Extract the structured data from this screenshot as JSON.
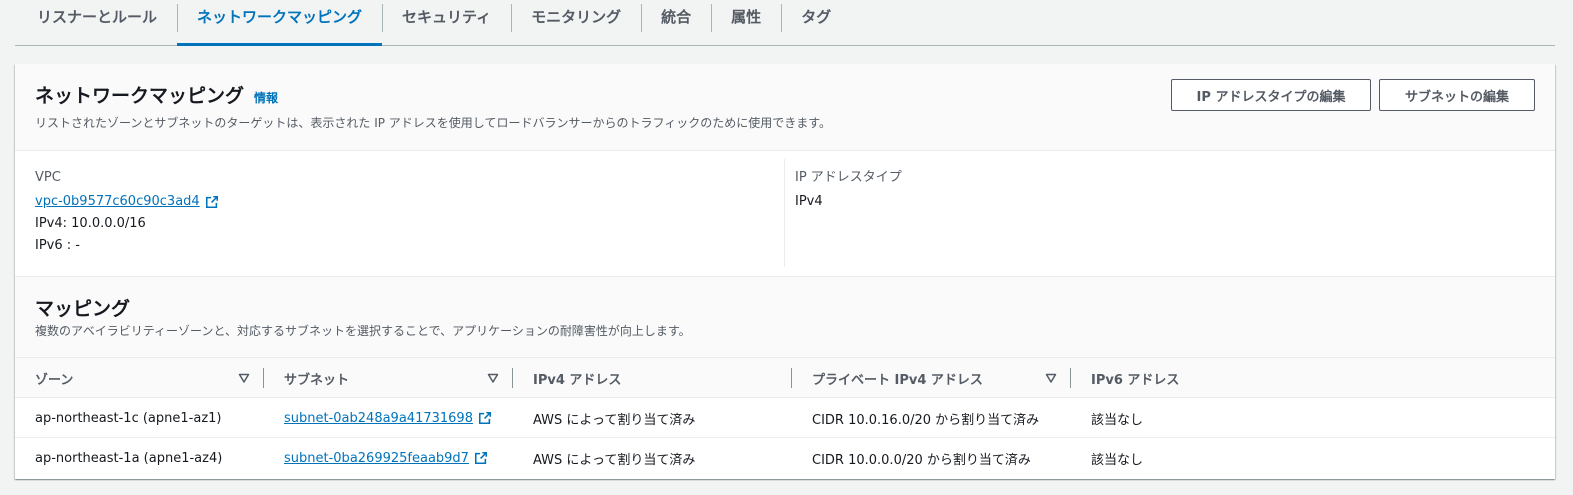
{
  "tabs": [
    {
      "label": "リスナーとルール",
      "active": false
    },
    {
      "label": "ネットワークマッピング",
      "active": true
    },
    {
      "label": "セキュリティ",
      "active": false
    },
    {
      "label": "モニタリング",
      "active": false
    },
    {
      "label": "統合",
      "active": false
    },
    {
      "label": "属性",
      "active": false
    },
    {
      "label": "タグ",
      "active": false
    }
  ],
  "header": {
    "title": "ネットワークマッピング",
    "info_link": "情報",
    "description": "リストされたゾーンとサブネットのターゲットは、表示された IP アドレスを使用してロードバランサーからのトラフィックのために使用できます。",
    "edit_ip_button": "IP アドレスタイプの編集",
    "edit_subnet_button": "サブネットの編集"
  },
  "details": {
    "vpc_label": "VPC",
    "vpc_link": "vpc-0b9577c60c90c3ad4",
    "ipv4": "IPv4: 10.0.0.0/16",
    "ipv6": "IPv6 : -",
    "ip_type_label": "IP アドレスタイプ",
    "ip_type_value": "IPv4"
  },
  "mappings": {
    "title": "マッピング",
    "description": "複数のアベイラビリティーゾーンと、対応するサブネットを選択することで、アプリケーションの耐障害性が向上します。",
    "columns": [
      "ゾーン",
      "サブネット",
      "IPv4 アドレス",
      "プライベート IPv4 アドレス",
      "IPv6 アドレス"
    ],
    "rows": [
      {
        "zone": "ap-northeast-1c (apne1-az1)",
        "subnet": "subnet-0ab248a9a41731698",
        "ipv4": "AWS によって割り当て済み",
        "private_ipv4": "CIDR 10.0.16.0/20 から割り当て済み",
        "ipv6": "該当なし"
      },
      {
        "zone": "ap-northeast-1a (apne1-az4)",
        "subnet": "subnet-0ba269925feaab9d7",
        "ipv4": "AWS によって割り当て済み",
        "private_ipv4": "CIDR 10.0.0.0/20 から割り当て済み",
        "ipv6": "該当なし"
      }
    ]
  },
  "colors": {
    "accent": "#0073bb",
    "text": "#16191f",
    "muted": "#545b64"
  },
  "icons": {
    "external_link": "external-link-icon",
    "sort": "sort-caret-icon"
  }
}
